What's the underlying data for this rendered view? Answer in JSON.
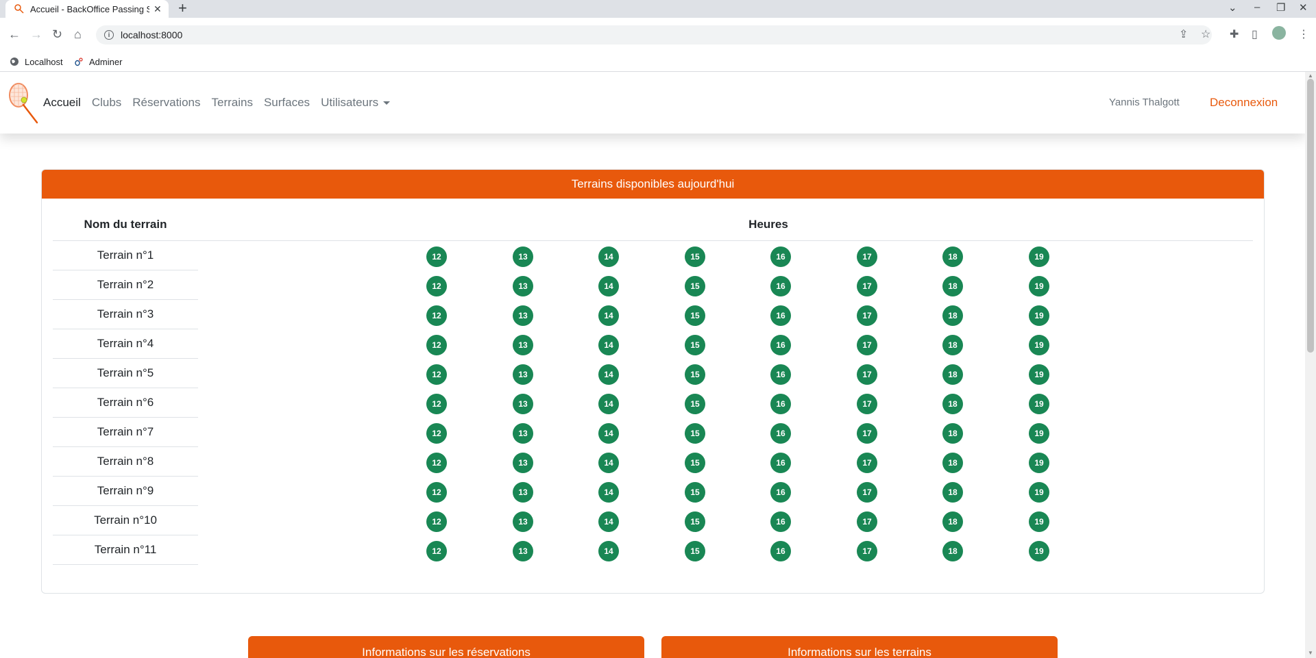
{
  "browser": {
    "tab_title": "Accueil - BackOffice Passing Shot",
    "url": "localhost:8000",
    "bookmarks": [
      {
        "label": "Localhost",
        "icon": "globe-icon"
      },
      {
        "label": "Adminer",
        "icon": "adminer-icon"
      }
    ]
  },
  "navbar": {
    "links": [
      "Accueil",
      "Clubs",
      "Réservations",
      "Terrains",
      "Surfaces",
      "Utilisateurs"
    ],
    "active": "Accueil",
    "user_name": "Yannis Thalgott",
    "logout_label": "Deconnexion"
  },
  "availability": {
    "header": "Terrains disponibles aujourd'hui",
    "col_name": "Nom du terrain",
    "col_hours": "Heures",
    "rows": [
      {
        "name": "Terrain n°1",
        "hours": [
          "12",
          "13",
          "14",
          "15",
          "16",
          "17",
          "18",
          "19"
        ]
      },
      {
        "name": "Terrain n°2",
        "hours": [
          "12",
          "13",
          "14",
          "15",
          "16",
          "17",
          "18",
          "19"
        ]
      },
      {
        "name": "Terrain n°3",
        "hours": [
          "12",
          "13",
          "14",
          "15",
          "16",
          "17",
          "18",
          "19"
        ]
      },
      {
        "name": "Terrain n°4",
        "hours": [
          "12",
          "13",
          "14",
          "15",
          "16",
          "17",
          "18",
          "19"
        ]
      },
      {
        "name": "Terrain n°5",
        "hours": [
          "12",
          "13",
          "14",
          "15",
          "16",
          "17",
          "18",
          "19"
        ]
      },
      {
        "name": "Terrain n°6",
        "hours": [
          "12",
          "13",
          "14",
          "15",
          "16",
          "17",
          "18",
          "19"
        ]
      },
      {
        "name": "Terrain n°7",
        "hours": [
          "12",
          "13",
          "14",
          "15",
          "16",
          "17",
          "18",
          "19"
        ]
      },
      {
        "name": "Terrain n°8",
        "hours": [
          "12",
          "13",
          "14",
          "15",
          "16",
          "17",
          "18",
          "19"
        ]
      },
      {
        "name": "Terrain n°9",
        "hours": [
          "12",
          "13",
          "14",
          "15",
          "16",
          "17",
          "18",
          "19"
        ]
      },
      {
        "name": "Terrain n°10",
        "hours": [
          "12",
          "13",
          "14",
          "15",
          "16",
          "17",
          "18",
          "19"
        ]
      },
      {
        "name": "Terrain n°11",
        "hours": [
          "12",
          "13",
          "14",
          "15",
          "16",
          "17",
          "18",
          "19"
        ]
      }
    ]
  },
  "info_cards": {
    "reservations": "Informations sur les réservations",
    "terrains": "Informations sur les terrains"
  },
  "colors": {
    "brand": "#e8590c",
    "slot_available": "#198754"
  }
}
